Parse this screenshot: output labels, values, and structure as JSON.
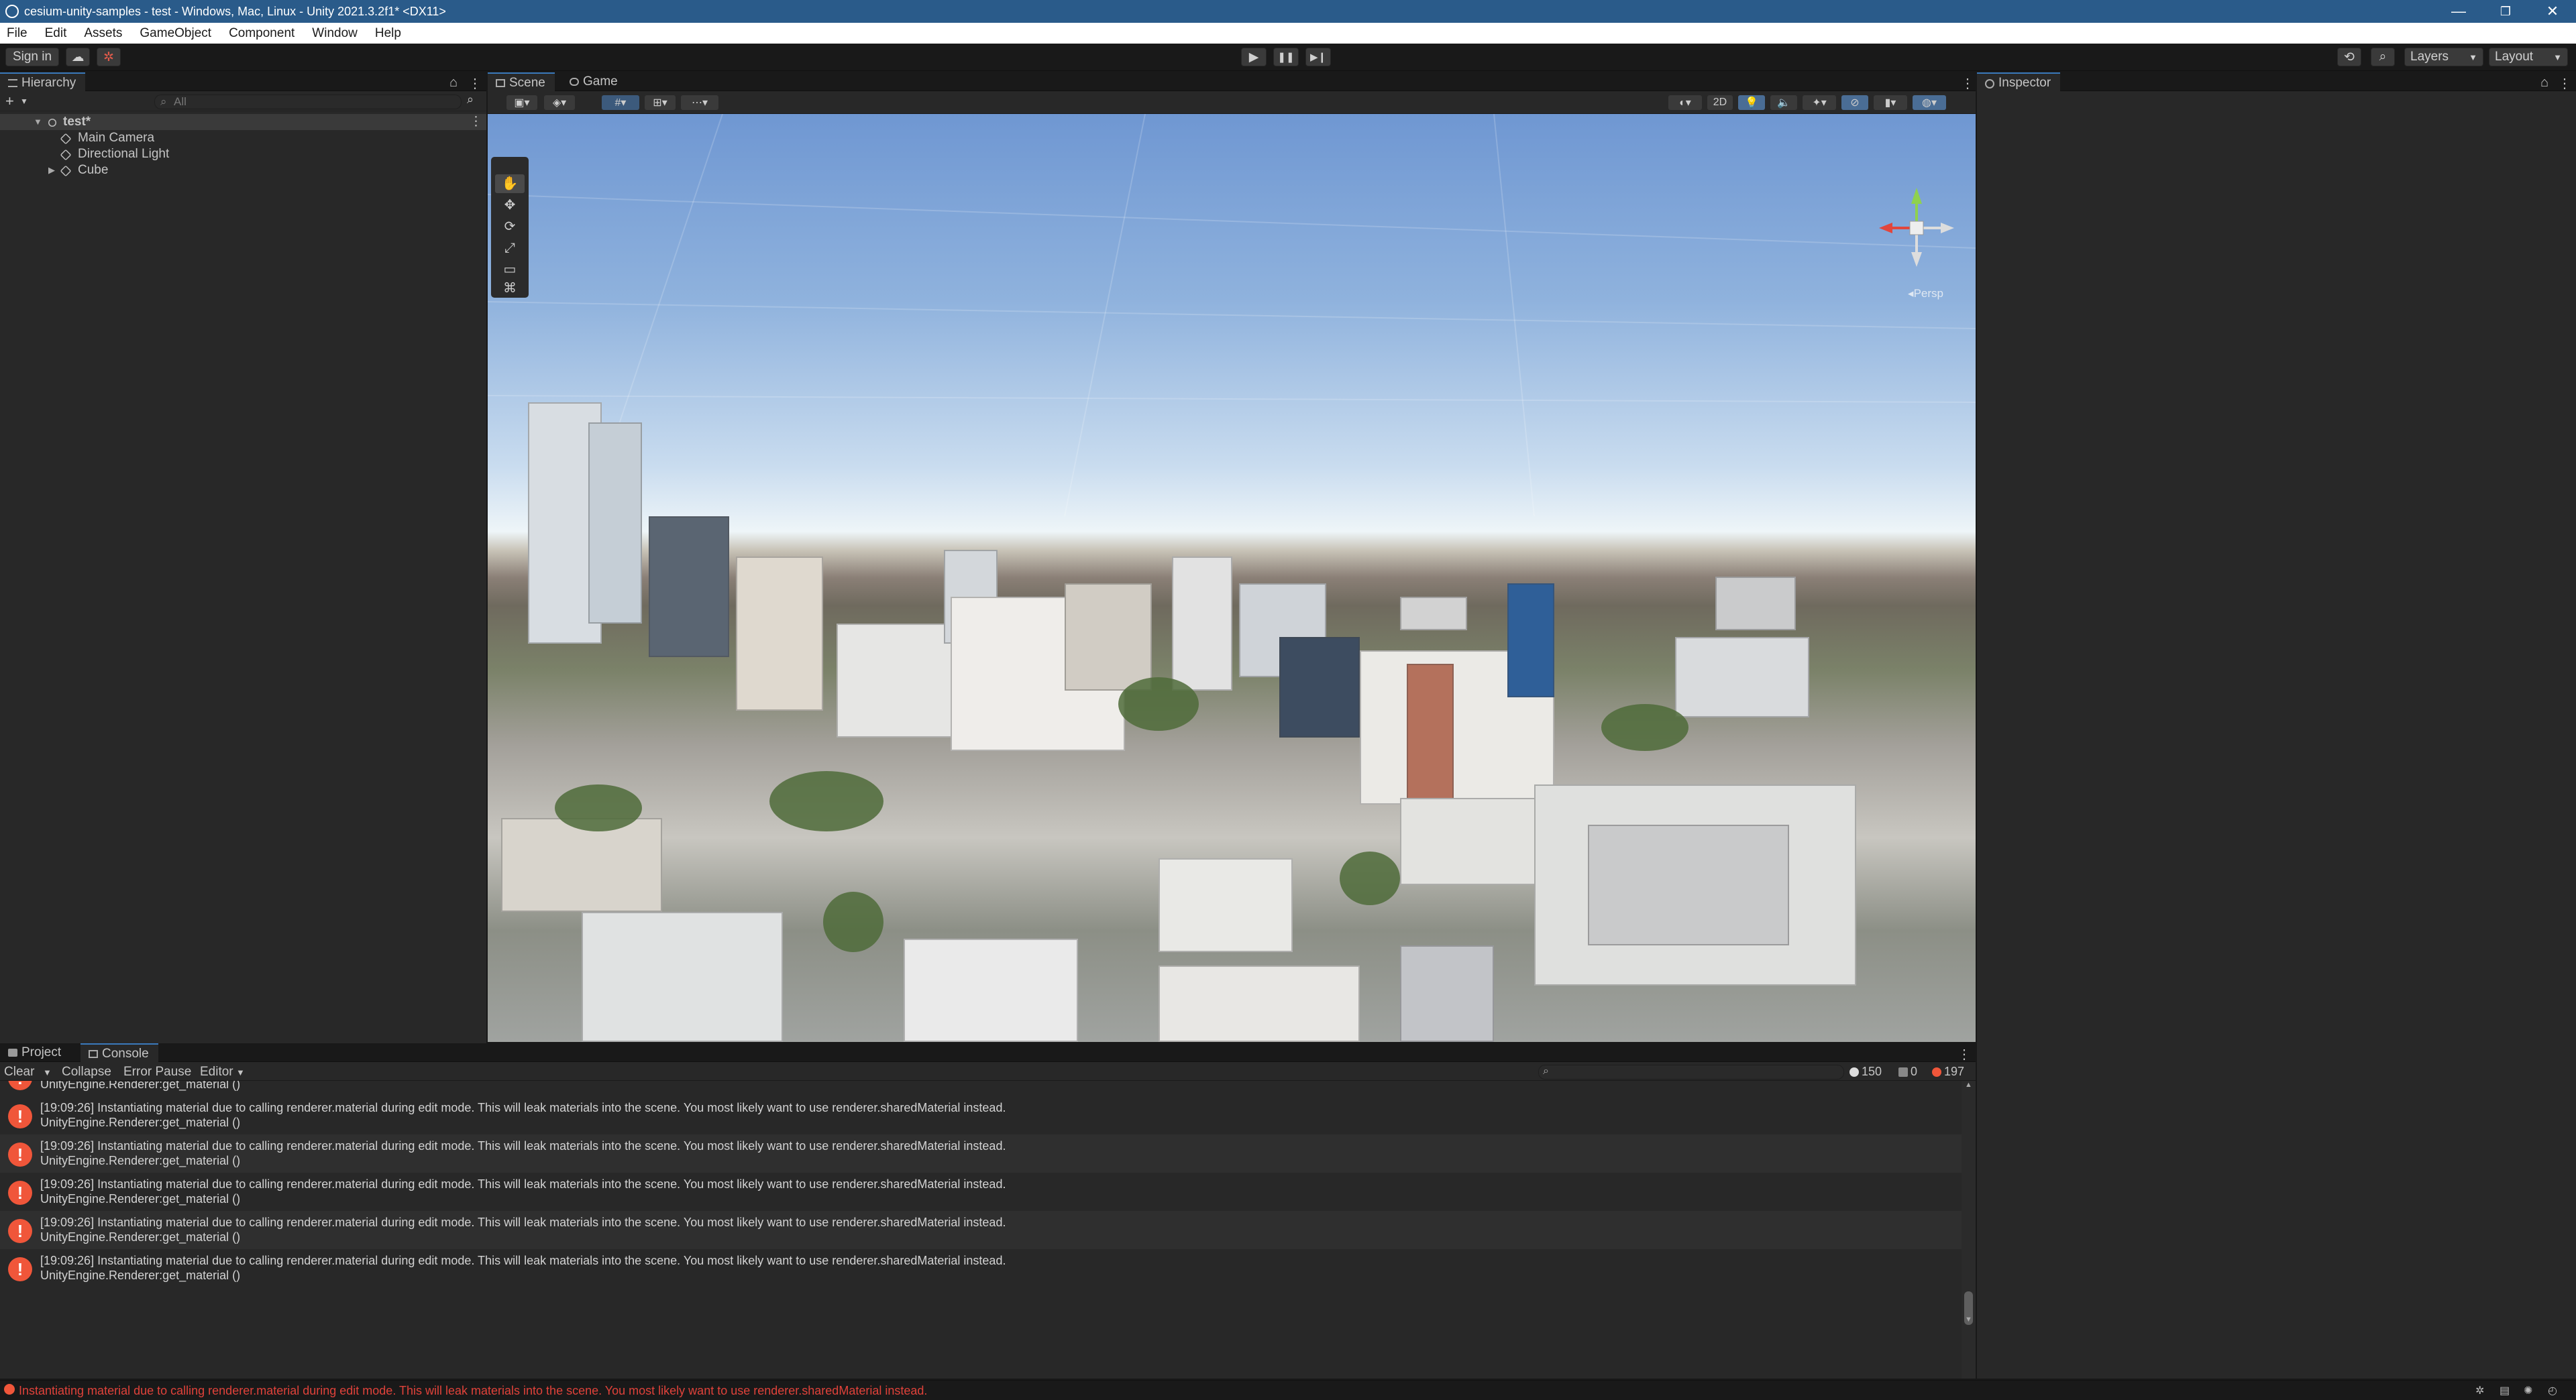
{
  "window": {
    "title": "cesium-unity-samples - test - Windows, Mac, Linux - Unity 2021.3.2f1* <DX11>",
    "controls": [
      "—",
      "❐",
      "✕"
    ]
  },
  "menu": [
    "File",
    "Edit",
    "Assets",
    "GameObject",
    "Component",
    "Window",
    "Help"
  ],
  "toolbar": {
    "sign_in": "Sign in",
    "layers": "Layers",
    "layout": "Layout"
  },
  "hierarchy": {
    "tab": "Hierarchy",
    "search_placeholder": "All",
    "scene_name": "test*",
    "items": [
      "Main Camera",
      "Directional Light",
      "Cube"
    ]
  },
  "scene_view": {
    "tabs": [
      "Scene",
      "Game"
    ],
    "mode_2d": "2D",
    "projection": "Persp"
  },
  "inspector": {
    "tab": "Inspector"
  },
  "console": {
    "tabs": [
      "Project",
      "Console"
    ],
    "buttons": [
      "Clear",
      "Collapse",
      "Error Pause",
      "Editor"
    ],
    "counts": {
      "log": "150",
      "warning": "0",
      "error": "197"
    },
    "partial_line": "UnityEngine.Renderer:get_material ()",
    "entries": [
      {
        "message": "[19:09:26] Instantiating material due to calling renderer.material during edit mode. This will leak materials into the scene. You most likely want to use renderer.sharedMaterial instead.",
        "trace": "UnityEngine.Renderer:get_material ()"
      },
      {
        "message": "[19:09:26] Instantiating material due to calling renderer.material during edit mode. This will leak materials into the scene. You most likely want to use renderer.sharedMaterial instead.",
        "trace": "UnityEngine.Renderer:get_material ()"
      },
      {
        "message": "[19:09:26] Instantiating material due to calling renderer.material during edit mode. This will leak materials into the scene. You most likely want to use renderer.sharedMaterial instead.",
        "trace": "UnityEngine.Renderer:get_material ()"
      },
      {
        "message": "[19:09:26] Instantiating material due to calling renderer.material during edit mode. This will leak materials into the scene. You most likely want to use renderer.sharedMaterial instead.",
        "trace": "UnityEngine.Renderer:get_material ()"
      },
      {
        "message": "[19:09:26] Instantiating material due to calling renderer.material during edit mode. This will leak materials into the scene. You most likely want to use renderer.sharedMaterial instead.",
        "trace": "UnityEngine.Renderer:get_material ()"
      }
    ]
  },
  "status_bar": {
    "message": "Instantiating material due to calling renderer.material during edit mode. This will leak materials into the scene. You most likely want to use renderer.sharedMaterial instead."
  },
  "colors": {
    "titlebar": "#2a5b8a",
    "accent_tab": "#3a79bb",
    "error": "#f0563a"
  }
}
